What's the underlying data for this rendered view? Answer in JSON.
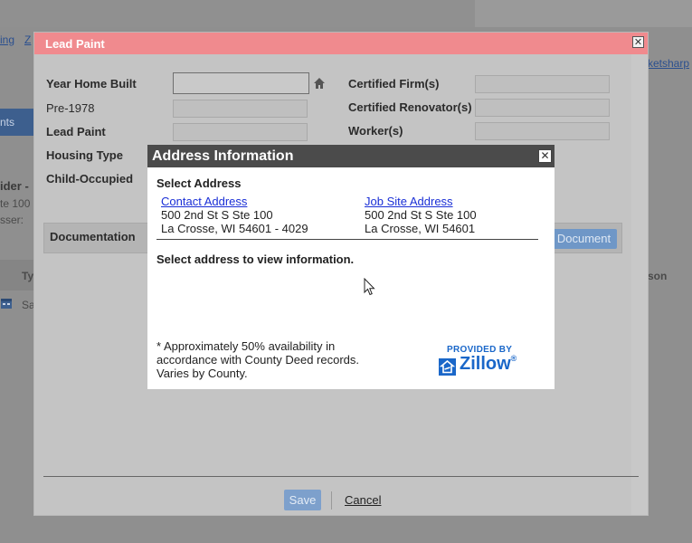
{
  "background": {
    "links": [
      "ing",
      "Z",
      "ketsharp"
    ],
    "tab_label": "nts",
    "text_fragments": [
      "ider -",
      "te 100",
      "sser:"
    ],
    "table_header": [
      "Ty",
      "son"
    ],
    "row_fragment": "Sa"
  },
  "lead_paint": {
    "title": "Lead Paint",
    "close_glyph": "✕",
    "fields_left": [
      {
        "label": "Year Home Built",
        "value": ""
      },
      {
        "label": "Pre-1978",
        "value": ""
      },
      {
        "label": "Lead Paint",
        "value": ""
      },
      {
        "label": "Housing Type",
        "value": ""
      },
      {
        "label": "Child-Occupied",
        "value": ""
      }
    ],
    "fields_right": [
      {
        "label": "Certified Firm(s)",
        "value": ""
      },
      {
        "label": "Certified Renovator(s)",
        "value": ""
      },
      {
        "label": "Worker(s)",
        "value": ""
      }
    ],
    "documentation_label": "Documentation",
    "document_button": "Document",
    "save_label": "Save",
    "cancel_label": "Cancel"
  },
  "address_info": {
    "title": "Address Information",
    "close_glyph": "✕",
    "heading": "Select Address",
    "contact": {
      "label": "Contact Address",
      "line1": "500 2nd St S Ste 100",
      "line2": "La Crosse, WI 54601 - 4029"
    },
    "job_site": {
      "label": "Job Site Address",
      "line1": "500 2nd St S Ste 100",
      "line2": "La Crosse, WI 54601"
    },
    "message": "Select address to view information.",
    "note": "* Approximately 50% availability in accordance with County Deed records. Varies by County.",
    "provided_by": "PROVIDED BY",
    "brand": "Zillow",
    "brand_suffix": "®"
  },
  "colors": {
    "lead_paint_titlebar": "#f08a8e",
    "address_titlebar": "#4b4b4b",
    "link": "#1a2fd6",
    "zillow": "#1a67c9"
  }
}
